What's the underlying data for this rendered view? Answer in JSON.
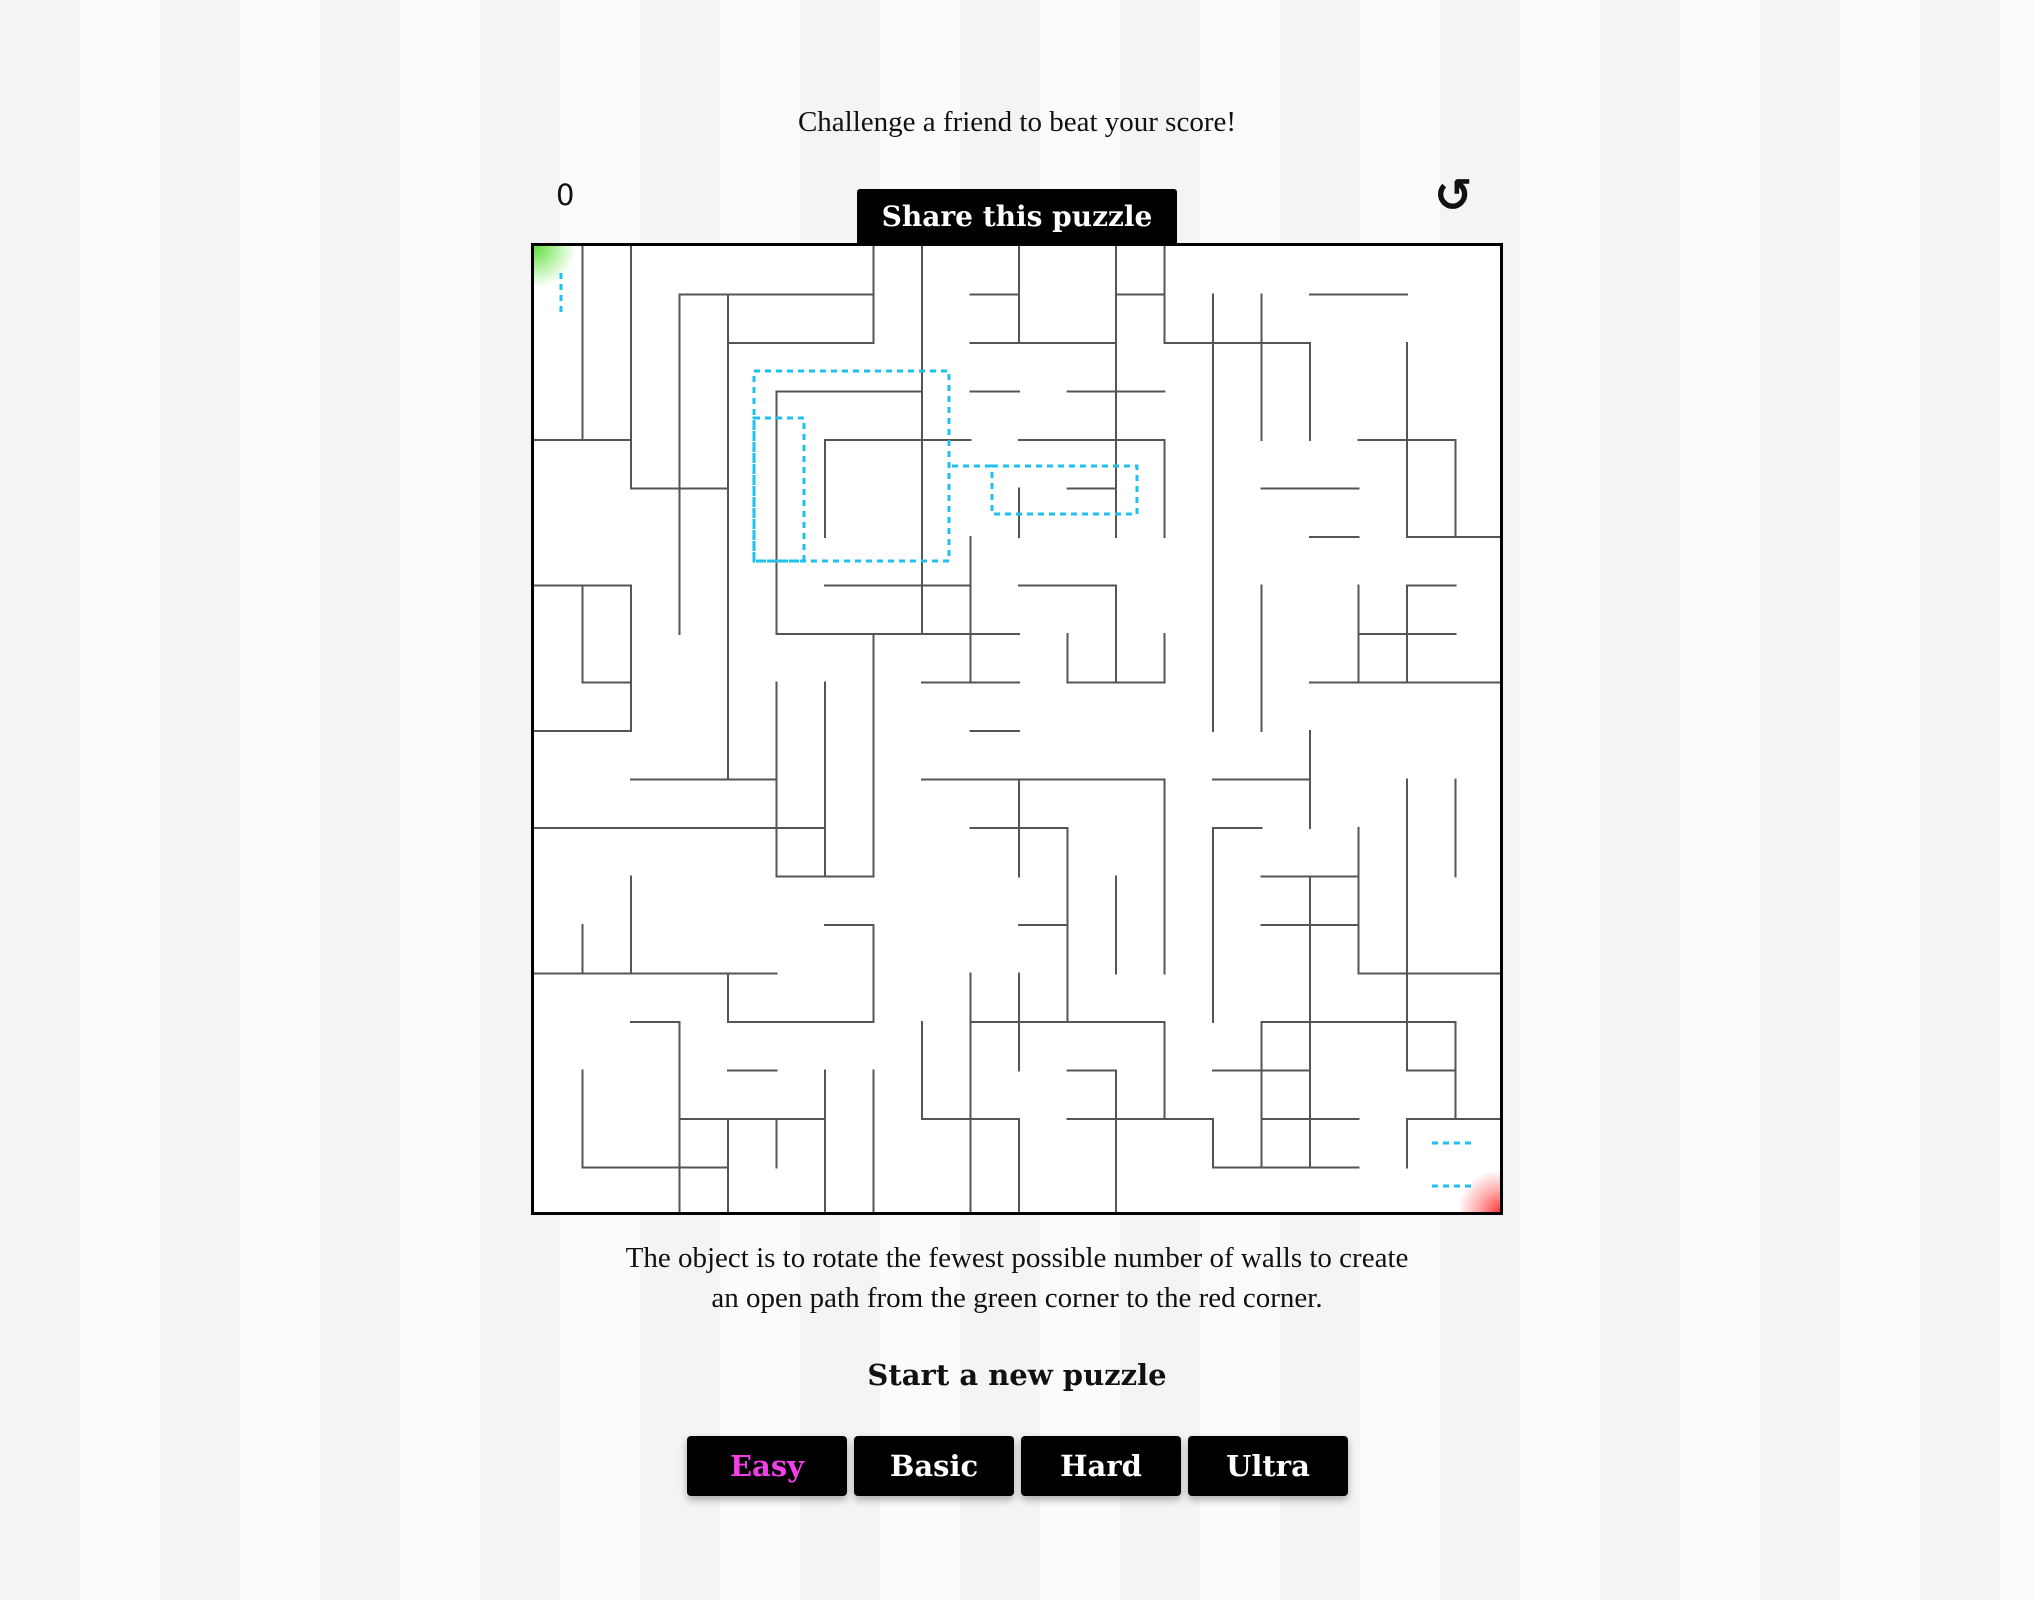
{
  "challenge_text": "Challenge a friend to beat your score!",
  "score": "0",
  "reset_icon": "↺",
  "share_label": "Share this puzzle",
  "instructions": {
    "line1": "The object is to rotate the fewest possible number of walls to create",
    "line2": "an open path from the green corner to the red corner."
  },
  "new_puzzle_label": "Start a new puzzle",
  "difficulties": [
    {
      "label": "Easy",
      "active": true
    },
    {
      "label": "Basic",
      "active": false
    },
    {
      "label": "Hard",
      "active": false
    },
    {
      "label": "Ultra",
      "active": false
    }
  ],
  "colors": {
    "start_corner": "#5edc3c",
    "end_corner": "#ff3c3c",
    "highlight_path": "#1ec0ee",
    "active_difficulty": "#f040e6",
    "wall": "#555555"
  },
  "icons": {
    "reset": "rotate-ccw-icon"
  }
}
